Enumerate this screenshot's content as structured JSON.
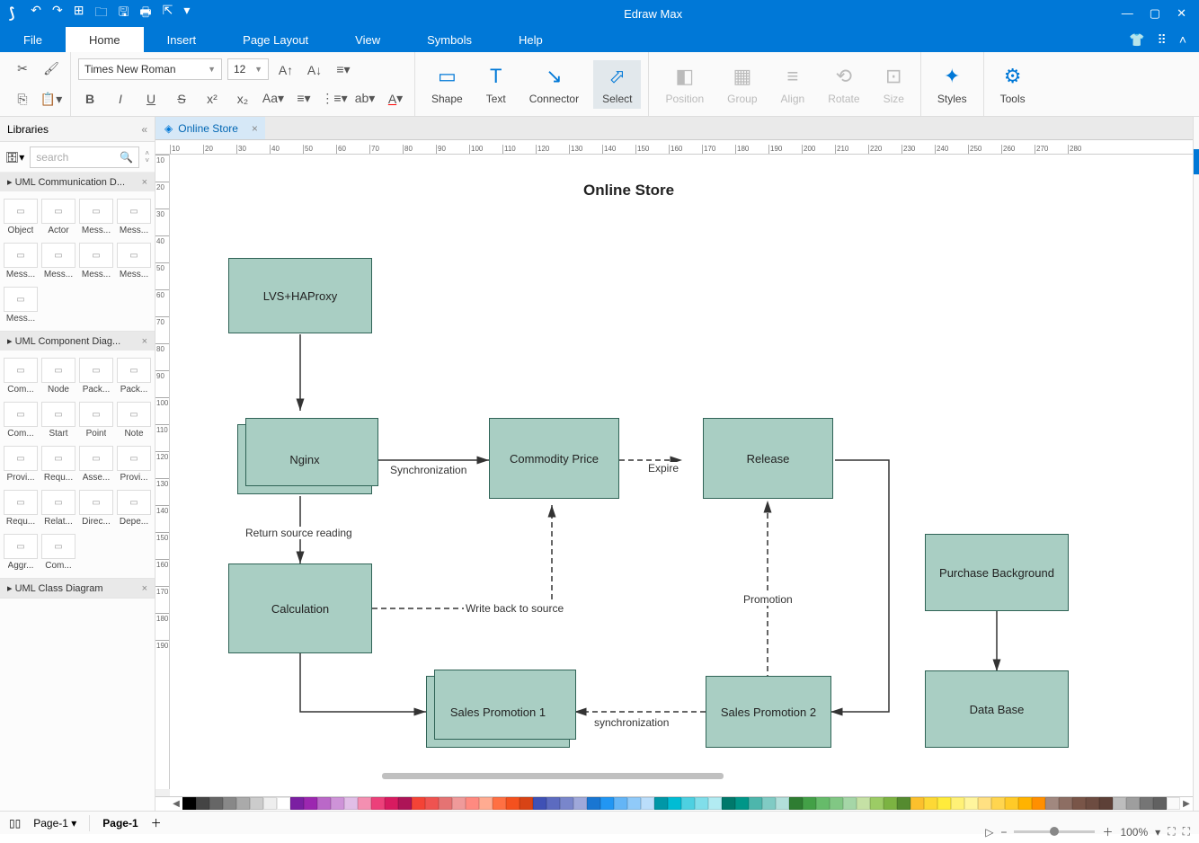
{
  "app": {
    "title": "Edraw Max"
  },
  "menus": [
    "File",
    "Home",
    "Insert",
    "Page Layout",
    "View",
    "Symbols",
    "Help"
  ],
  "active_menu": "Home",
  "ribbon": {
    "font": "Times New Roman",
    "size": "12",
    "big": [
      "Shape",
      "Text",
      "Connector",
      "Select",
      "Position",
      "Group",
      "Align",
      "Rotate",
      "Size",
      "Styles",
      "Tools"
    ]
  },
  "sidebar": {
    "title": "Libraries",
    "search_placeholder": "search",
    "sections": [
      {
        "title": "UML Communication D...",
        "items": [
          "Object",
          "Actor",
          "Mess...",
          "Mess...",
          "Mess...",
          "Mess...",
          "Mess...",
          "Mess...",
          "Mess..."
        ]
      },
      {
        "title": "UML Component Diag...",
        "items": [
          "Com...",
          "Node",
          "Pack...",
          "Pack...",
          "Com...",
          "Start",
          "Point",
          "Note",
          "Provi...",
          "Requ...",
          "Asse...",
          "Provi...",
          "Requ...",
          "Relat...",
          "Direc...",
          "Depe...",
          "Aggr...",
          "Com..."
        ]
      },
      {
        "title": "UML Class Diagram",
        "items": []
      }
    ]
  },
  "document": {
    "tab": "Online Store",
    "page_name": "Page-1"
  },
  "ruler_h": [
    "10",
    "20",
    "30",
    "40",
    "50",
    "60",
    "70",
    "80",
    "90",
    "100",
    "110",
    "120",
    "130",
    "140",
    "150",
    "160",
    "170",
    "180",
    "190",
    "200",
    "210",
    "220",
    "230",
    "240",
    "250",
    "260",
    "270",
    "280"
  ],
  "ruler_v": [
    "10",
    "20",
    "30",
    "40",
    "50",
    "60",
    "70",
    "80",
    "90",
    "100",
    "110",
    "120",
    "130",
    "140",
    "150",
    "160",
    "170",
    "180",
    "190"
  ],
  "zoom": "100%",
  "diagram": {
    "title": "Online Store",
    "nodes": {
      "lvs": "LVS+HAProxy",
      "nginx": "Nginx",
      "commodity": "Commodity Price",
      "release": "Release",
      "calculation": "Calculation",
      "sales1": "Sales Promotion 1",
      "sales2": "Sales Promotion 2",
      "purchase": "Purchase Background",
      "database": "Data Base"
    },
    "edge_labels": {
      "sync": "Synchronization",
      "return": "Return source reading",
      "writeback": "Write back to source",
      "expire": "Expire",
      "promotion": "Promotion",
      "sync2": "synchronization"
    }
  },
  "colorbar": [
    "#000",
    "#444",
    "#666",
    "#888",
    "#aaa",
    "#ccc",
    "#eee",
    "#fff",
    "#7b1fa2",
    "#9c27b0",
    "#ba68c8",
    "#ce93d8",
    "#e1bee7",
    "#f48fb1",
    "#ec407a",
    "#d81b60",
    "#ad1457",
    "#f44336",
    "#ef5350",
    "#e57373",
    "#ef9a9a",
    "#ff8a80",
    "#ffab91",
    "#ff7043",
    "#f4511e",
    "#d84315",
    "#3f51b5",
    "#5c6bc0",
    "#7986cb",
    "#9fa8da",
    "#1976d2",
    "#2196f3",
    "#64b5f6",
    "#90caf9",
    "#bbdefb",
    "#0097a7",
    "#00bcd4",
    "#4dd0e1",
    "#80deea",
    "#b2ebf2",
    "#00796b",
    "#009688",
    "#4db6ac",
    "#80cbc4",
    "#b2dfdb",
    "#2e7d32",
    "#43a047",
    "#66bb6a",
    "#81c784",
    "#a5d6a7",
    "#c5e1a5",
    "#9ccc65",
    "#7cb342",
    "#558b2f",
    "#fbc02d",
    "#fdd835",
    "#ffeb3b",
    "#fff176",
    "#fff59d",
    "#ffe082",
    "#ffd54f",
    "#ffca28",
    "#ffb300",
    "#ff8f00",
    "#a1887f",
    "#8d6e63",
    "#795548",
    "#6d4c41",
    "#5d4037",
    "#bdbdbd",
    "#9e9e9e",
    "#757575",
    "#616161",
    "#fafafa"
  ]
}
